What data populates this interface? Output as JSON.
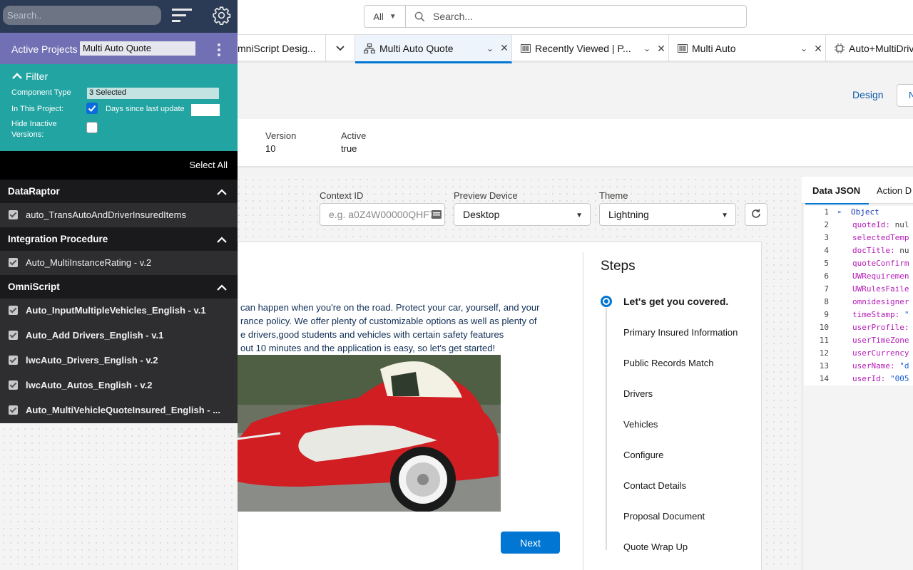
{
  "global_search": {
    "scope": "All",
    "placeholder": "Search..."
  },
  "tabs": [
    {
      "label": "mniScript Desig..."
    },
    {
      "label": "Multi Auto Quote"
    },
    {
      "label": "Recently Viewed | P..."
    },
    {
      "label": "Multi Auto"
    },
    {
      "label": "Auto+MultiDriv"
    }
  ],
  "header": {
    "design_label": "Design",
    "button_label": "N"
  },
  "record_meta": [
    {
      "label": "Version",
      "value": "10"
    },
    {
      "label": "Active",
      "value": "true"
    }
  ],
  "preview_controls": {
    "context_label": "Context ID",
    "context_placeholder": "e.g. a0Z4W00000QHF7",
    "device_label": "Preview Device",
    "device_value": "Desktop",
    "theme_label": "Theme",
    "theme_value": "Lightning"
  },
  "preview": {
    "intro_lines": [
      "can happen when you're on the road. Protect your car, yourself, and your",
      "rance policy. We offer plenty of customizable options as well as plenty of",
      "e drivers,good students and vehicles with certain safety features",
      "out 10 minutes and the application is easy, so let's get started!"
    ],
    "next_label": "Next",
    "steps_title": "Steps",
    "steps": [
      "Let's get you covered.",
      "Primary Insured Information",
      "Public Records Match",
      "Drivers",
      "Vehicles",
      "Configure",
      "Contact Details",
      "Proposal Document",
      "Quote Wrap Up"
    ]
  },
  "json_panel": {
    "tabs": [
      "Data JSON",
      "Action D"
    ],
    "root_label": "Object",
    "lines": [
      {
        "num": "1",
        "key": "",
        "value": ""
      },
      {
        "num": "2",
        "key": "quoteId:",
        "value": "nul"
      },
      {
        "num": "3",
        "key": "selectedTemp",
        "value": ""
      },
      {
        "num": "4",
        "key": "docTitle:",
        "value": "nu"
      },
      {
        "num": "5",
        "key": "quoteConfirm",
        "value": ""
      },
      {
        "num": "6",
        "key": "UWRequiremen",
        "value": ""
      },
      {
        "num": "7",
        "key": "UWRulesFaile",
        "value": ""
      },
      {
        "num": "8",
        "key": "omnidesigner",
        "value": ""
      },
      {
        "num": "9",
        "key": "timeStamp:",
        "value": "\""
      },
      {
        "num": "10",
        "key": "userProfile:",
        "value": ""
      },
      {
        "num": "11",
        "key": "userTimeZone",
        "value": ""
      },
      {
        "num": "12",
        "key": "userCurrency",
        "value": ""
      },
      {
        "num": "13",
        "key": "userName:",
        "value": "\"d"
      },
      {
        "num": "14",
        "key": "userId:",
        "value": "\"005"
      }
    ]
  },
  "designer_panel": {
    "search_placeholder": "Search..",
    "active_projects_label": "Active Projects",
    "active_project": "Multi Auto Quote",
    "filter": {
      "title": "Filter",
      "component_type_label": "Component Type",
      "component_type_value": "3 Selected",
      "in_project_label": "In This Project:",
      "in_project_checked": true,
      "days_label": "Days since last update",
      "hide_inactive_label_1": "Hide Inactive",
      "hide_inactive_label_2": "Versions:",
      "hide_inactive_checked": false
    },
    "select_all": "Select All",
    "groups": [
      {
        "title": "DataRaptor",
        "items": [
          "auto_TransAutoAndDriverInsuredItems"
        ]
      },
      {
        "title": "Integration Procedure",
        "items": [
          "Auto_MultiInstanceRating - v.2"
        ]
      },
      {
        "title": "OmniScript",
        "items": [
          "Auto_InputMultipleVehicles_English - v.1",
          "Auto_Add Drivers_English - v.1",
          "lwcAuto_Drivers_English - v.2",
          "lwcAuto_Autos_English - v.2",
          "Auto_MultiVehicleQuoteInsured_English - ..."
        ]
      }
    ]
  },
  "colors": {
    "brand_blue": "#0176d3",
    "panel_header": "#2c3b55",
    "projects_bar": "#7270b4",
    "filter_teal": "#21a4a2"
  }
}
